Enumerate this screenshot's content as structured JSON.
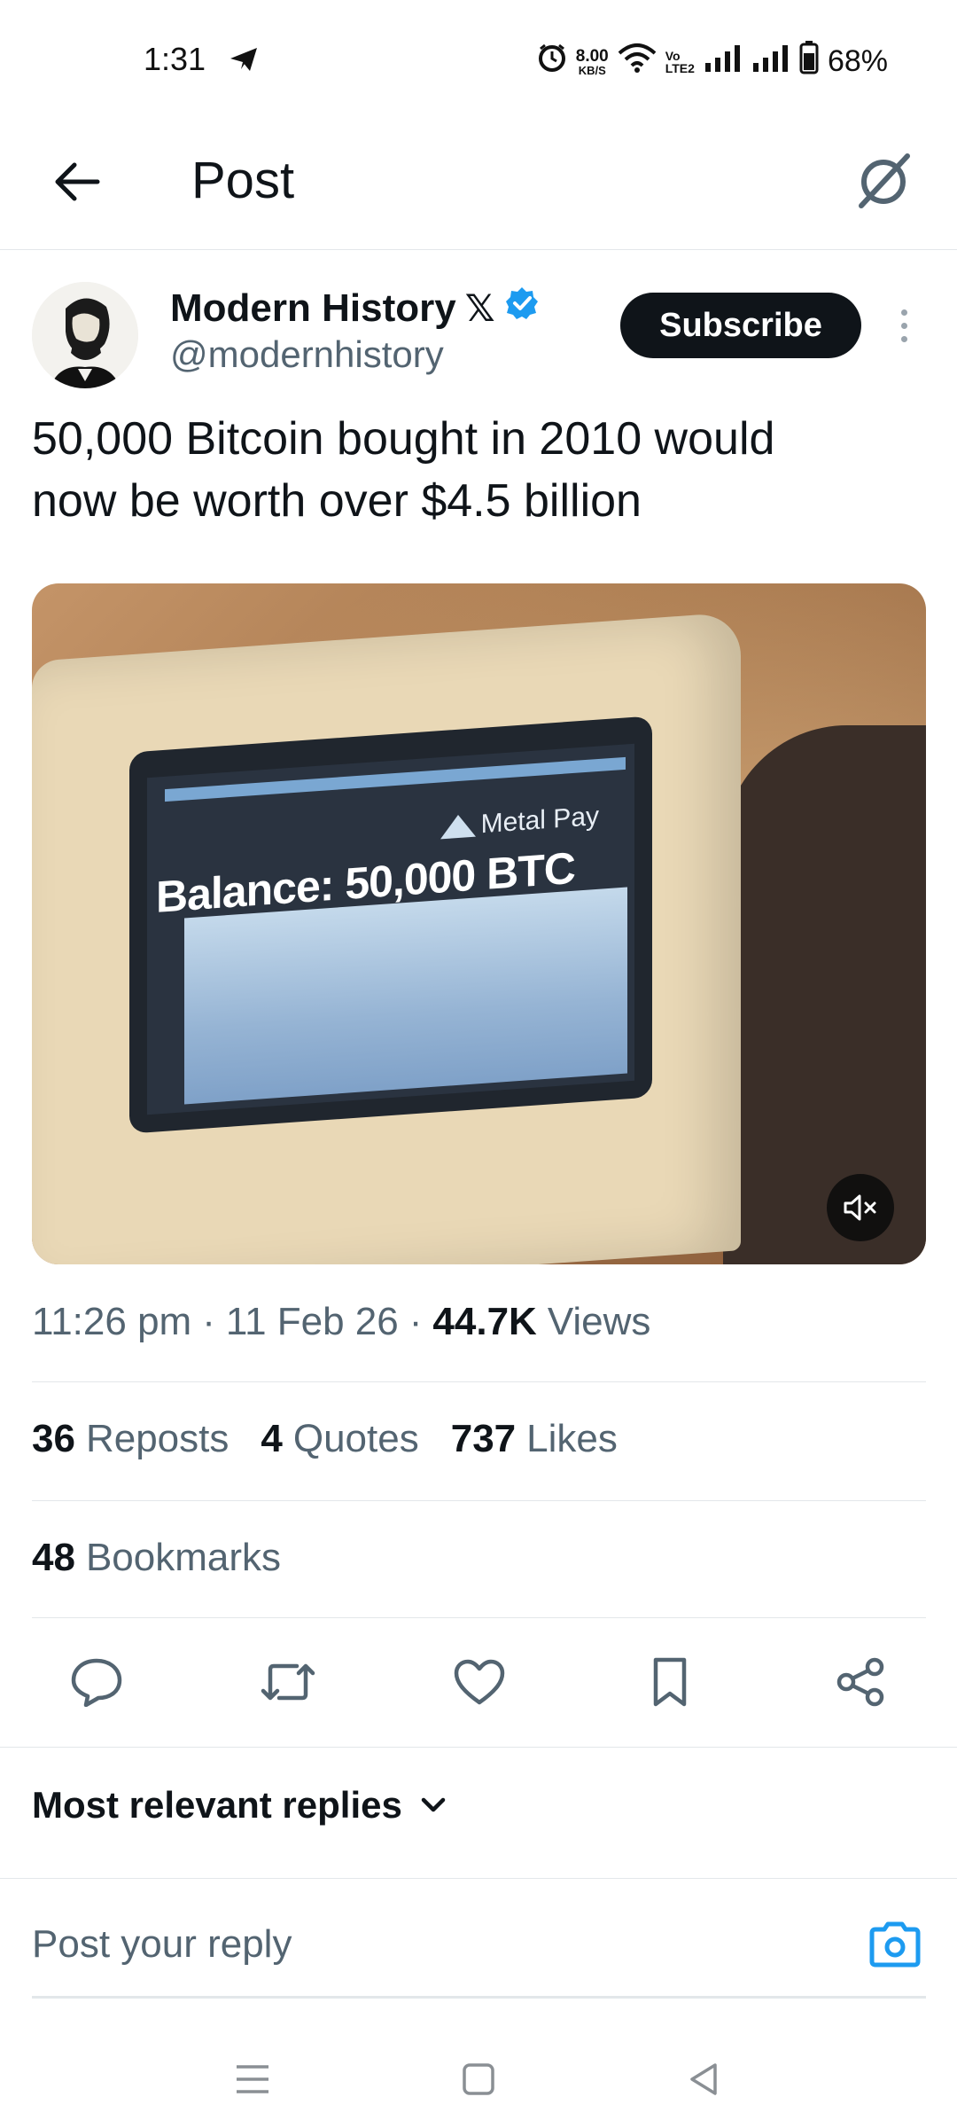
{
  "status_bar": {
    "time": "1:31",
    "net_speed": "8.00",
    "net_unit": "KB/S",
    "volte": [
      "Vo",
      "LTE2"
    ],
    "battery": "68%"
  },
  "header": {
    "title": "Post",
    "back_icon": "arrow-left-icon",
    "grok_icon": "grok-icon"
  },
  "post": {
    "author_name": "Modern History",
    "author_badge": "𝕏",
    "author_handle": "@modernhistory",
    "subscribe_label": "Subscribe",
    "text_line1": "50,000 Bitcoin bought in 2010 would",
    "text_line2": "now be worth over $4.5 billion",
    "media": {
      "screen_brand": "Metal Pay",
      "screen_text": "Balance: 50,000 BTC"
    },
    "time": "11:26 pm",
    "date": "11 Feb 26",
    "views_count": "44.7K",
    "views_label": "Views",
    "separator": "·"
  },
  "stats": {
    "reposts_count": "36",
    "reposts_label": "Reposts",
    "quotes_count": "4",
    "quotes_label": "Quotes",
    "likes_count": "737",
    "likes_label": "Likes",
    "bookmarks_count": "48",
    "bookmarks_label": "Bookmarks"
  },
  "replies": {
    "sort_label": "Most relevant replies",
    "input_placeholder": "Post your reply"
  },
  "colors": {
    "text": "#0f1419",
    "secondary": "#536471",
    "accent": "#1d9bf0",
    "divider": "#e3e7ea"
  }
}
